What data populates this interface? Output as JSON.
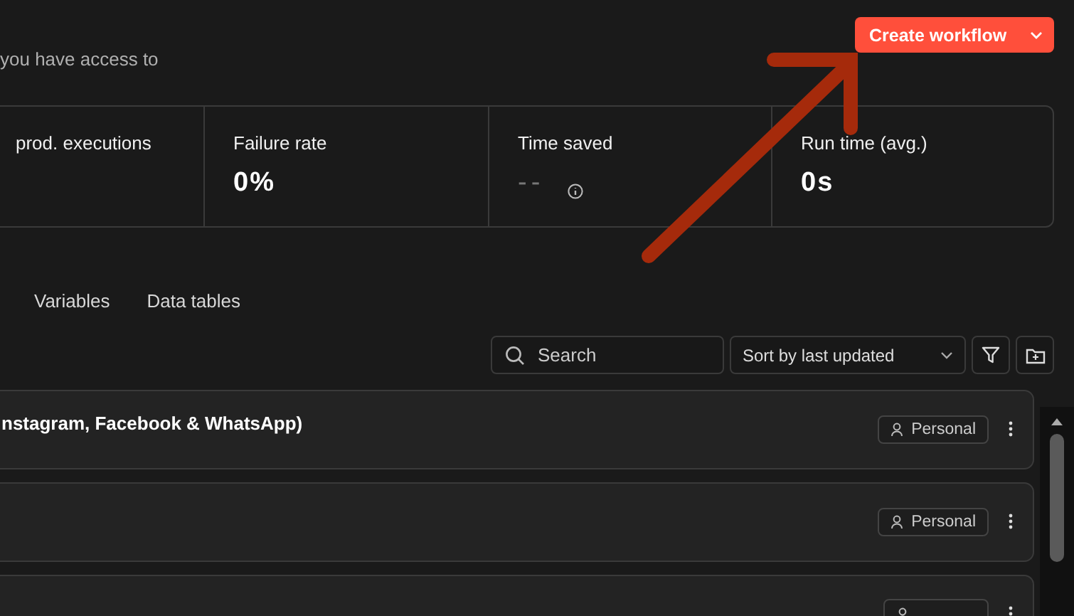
{
  "header": {
    "subtitle": "you have access to",
    "create_button": {
      "label": "Create workflow"
    }
  },
  "stats": [
    {
      "label": "prod. executions"
    },
    {
      "label": "Failure rate",
      "value": "0%"
    },
    {
      "label": "Time saved",
      "value": "--",
      "muted": true,
      "info": true
    },
    {
      "label": "Run time (avg.)",
      "value": "0s"
    }
  ],
  "tabs": [
    {
      "label": "Variables",
      "selected": false
    },
    {
      "label": "Data tables",
      "selected": false
    }
  ],
  "toolbar": {
    "search": {
      "placeholder": "Search"
    },
    "sort": {
      "value": "Sort by last updated"
    }
  },
  "workflows": [
    {
      "title": "nstagram, Facebook & WhatsApp)",
      "owner": "Personal"
    },
    {
      "owner": "Personal"
    },
    {
      "owner_badge": true
    }
  ]
}
